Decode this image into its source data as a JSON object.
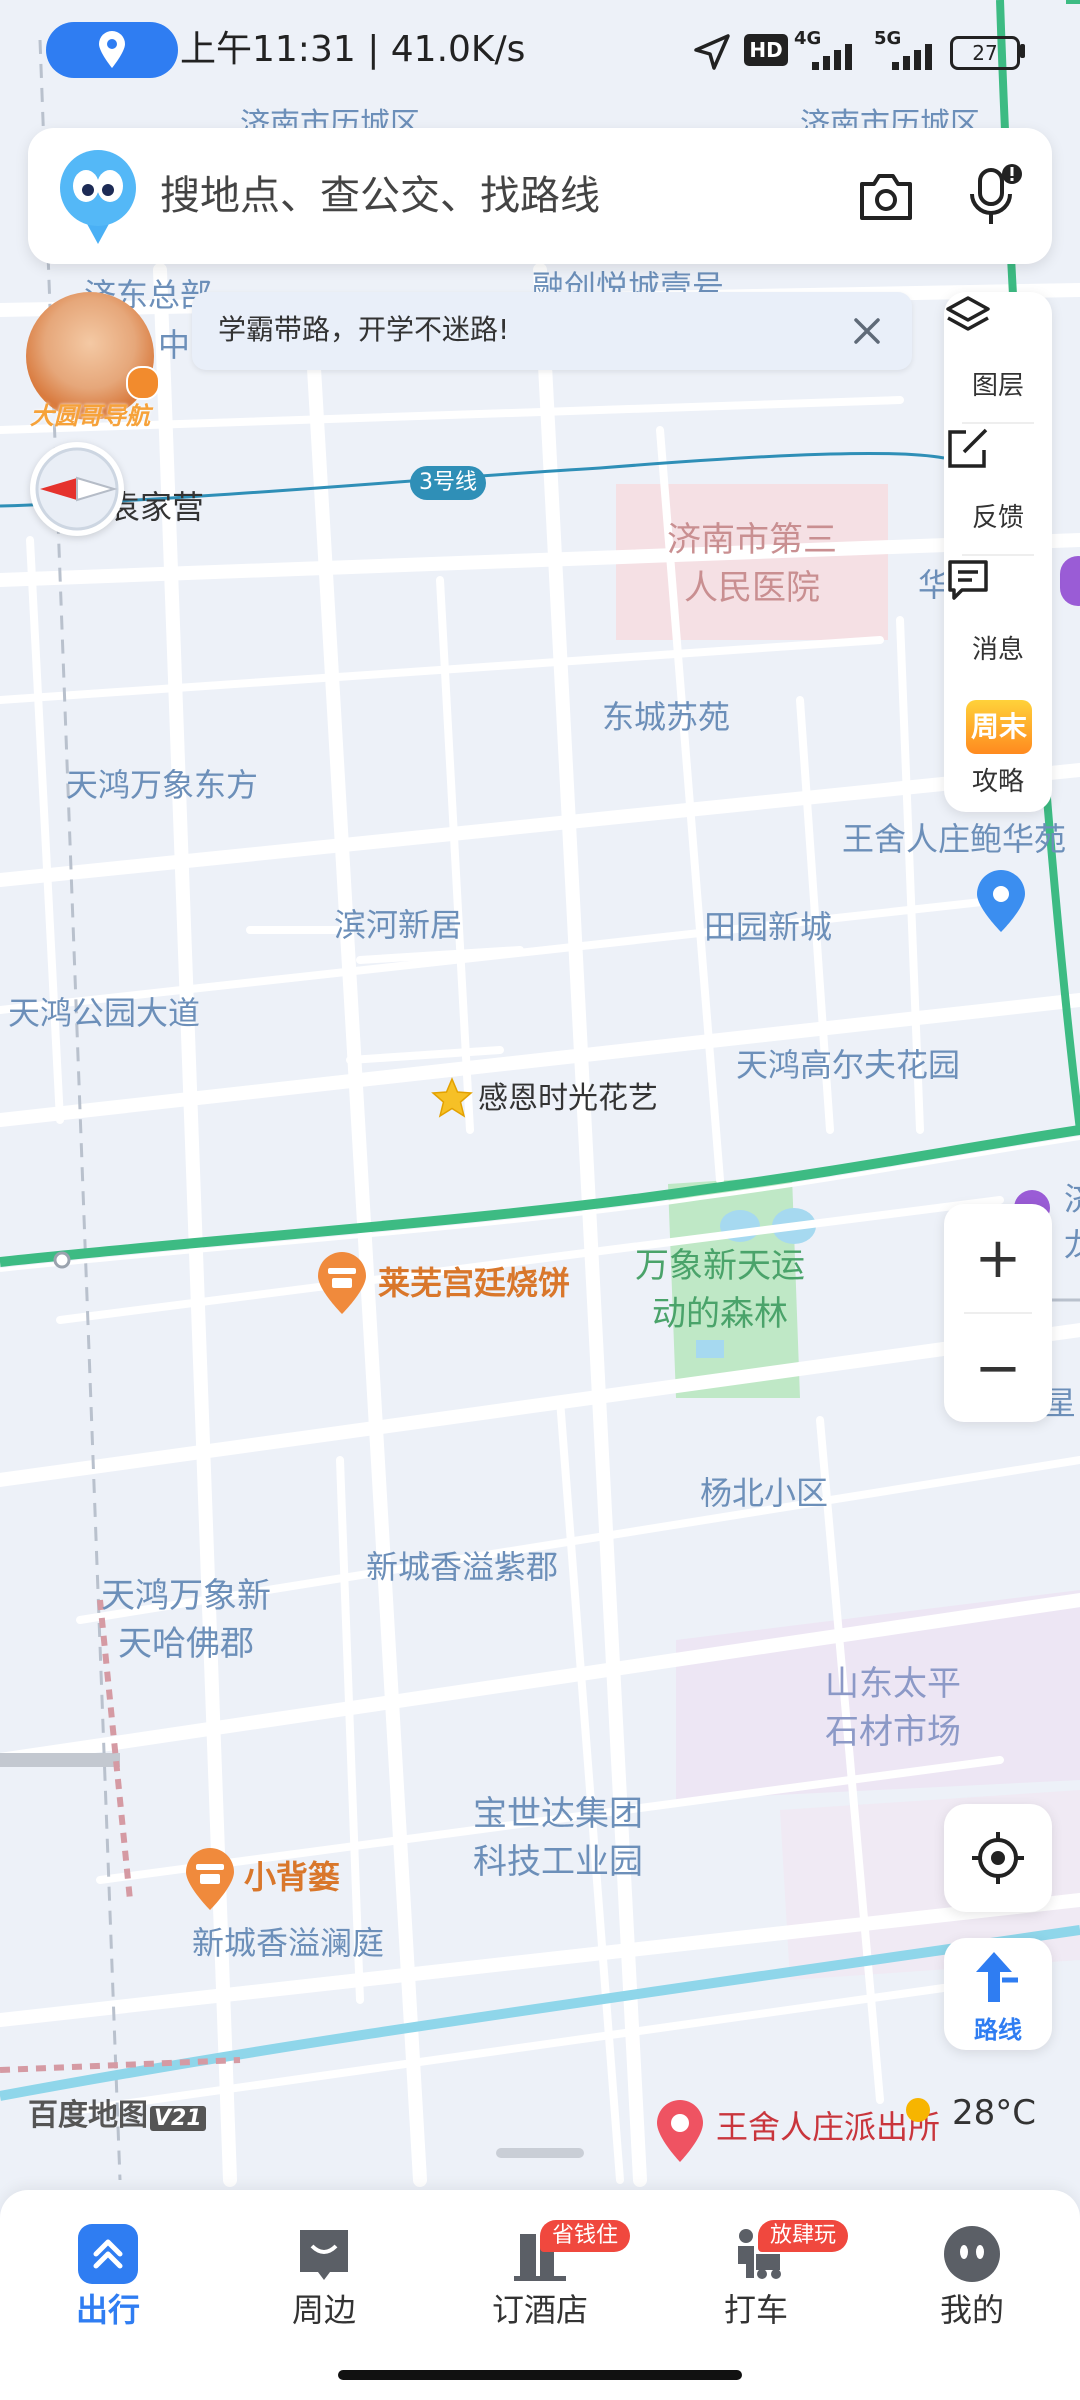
{
  "status_bar": {
    "time_speed": "上午11:31 | 41.0K/s",
    "signal_hd": "HD",
    "net1": "4G",
    "net2": "5G",
    "battery": "27"
  },
  "search": {
    "placeholder": "搜地点、查公交、找路线"
  },
  "avatar": {
    "badge": "大圆哥导航"
  },
  "banner": {
    "text": "学霸带路，开学不迷路!"
  },
  "right_panel": {
    "layers": "图层",
    "feedback": "反馈",
    "messages": "消息",
    "weekend_icon_text": "周末",
    "guide": "攻略"
  },
  "zoom": {
    "plus": "+",
    "minus": "−"
  },
  "route_button": {
    "label": "路线"
  },
  "map": {
    "metro_line": "3号线",
    "labels": {
      "top_left_cut": "济南市历城区",
      "top_right_cut": "济南市历城区",
      "jidong": "济东总部",
      "zhong": "中",
      "rongyu": "融创悦城壹号",
      "yuanjiaying": "袁家营",
      "hospital": "济南市第三人民医院",
      "hua": "华",
      "dongcheng": "东城苏苑",
      "tianhong_df": "天鸿万象东方",
      "wangshe_bao": "王舍人庄鲍华苑",
      "binhe": "滨河新居",
      "tianyuan": "田园新城",
      "tianhong_park": "天鸿公园大道",
      "tianhong_golf": "天鸿高尔夫花园",
      "ganen": "感恩时光花艺",
      "laiwu": "莱芜宫廷烧饼",
      "wanxiang_forest": "万象新天运动的森林",
      "yangbei": "杨北小区",
      "xincheng_zijun": "新城香溢紫郡",
      "tianhong_haf": "天鸿万象新天哈佛郡",
      "taiping": "山东太平石材市场",
      "baoshida": "宝世达集团科技工业园",
      "xiaobeilou": "小背篓",
      "xincheng_lanting": "新城香溢澜庭",
      "police": "王舍人庄派出所",
      "xing": "星",
      "ji_cut": "济",
      "long_cut": "龙"
    },
    "logo": "百度地图",
    "logo_version": "V21",
    "weather": "28°C"
  },
  "bottom_nav": {
    "items": [
      {
        "label": "出行"
      },
      {
        "label": "周边"
      },
      {
        "label": "订酒店",
        "badge": "省钱住"
      },
      {
        "label": "打车",
        "badge": "放肆玩"
      },
      {
        "label": "我的"
      }
    ]
  },
  "colors": {
    "accent": "#2f7df2",
    "badge_red": "#f0483e",
    "map_bg": "#edf1f8",
    "road_green": "#3dbb83",
    "metro": "#2f8fb7",
    "label_blue": "#6c8fb9",
    "poi_orange": "#d9772b"
  }
}
